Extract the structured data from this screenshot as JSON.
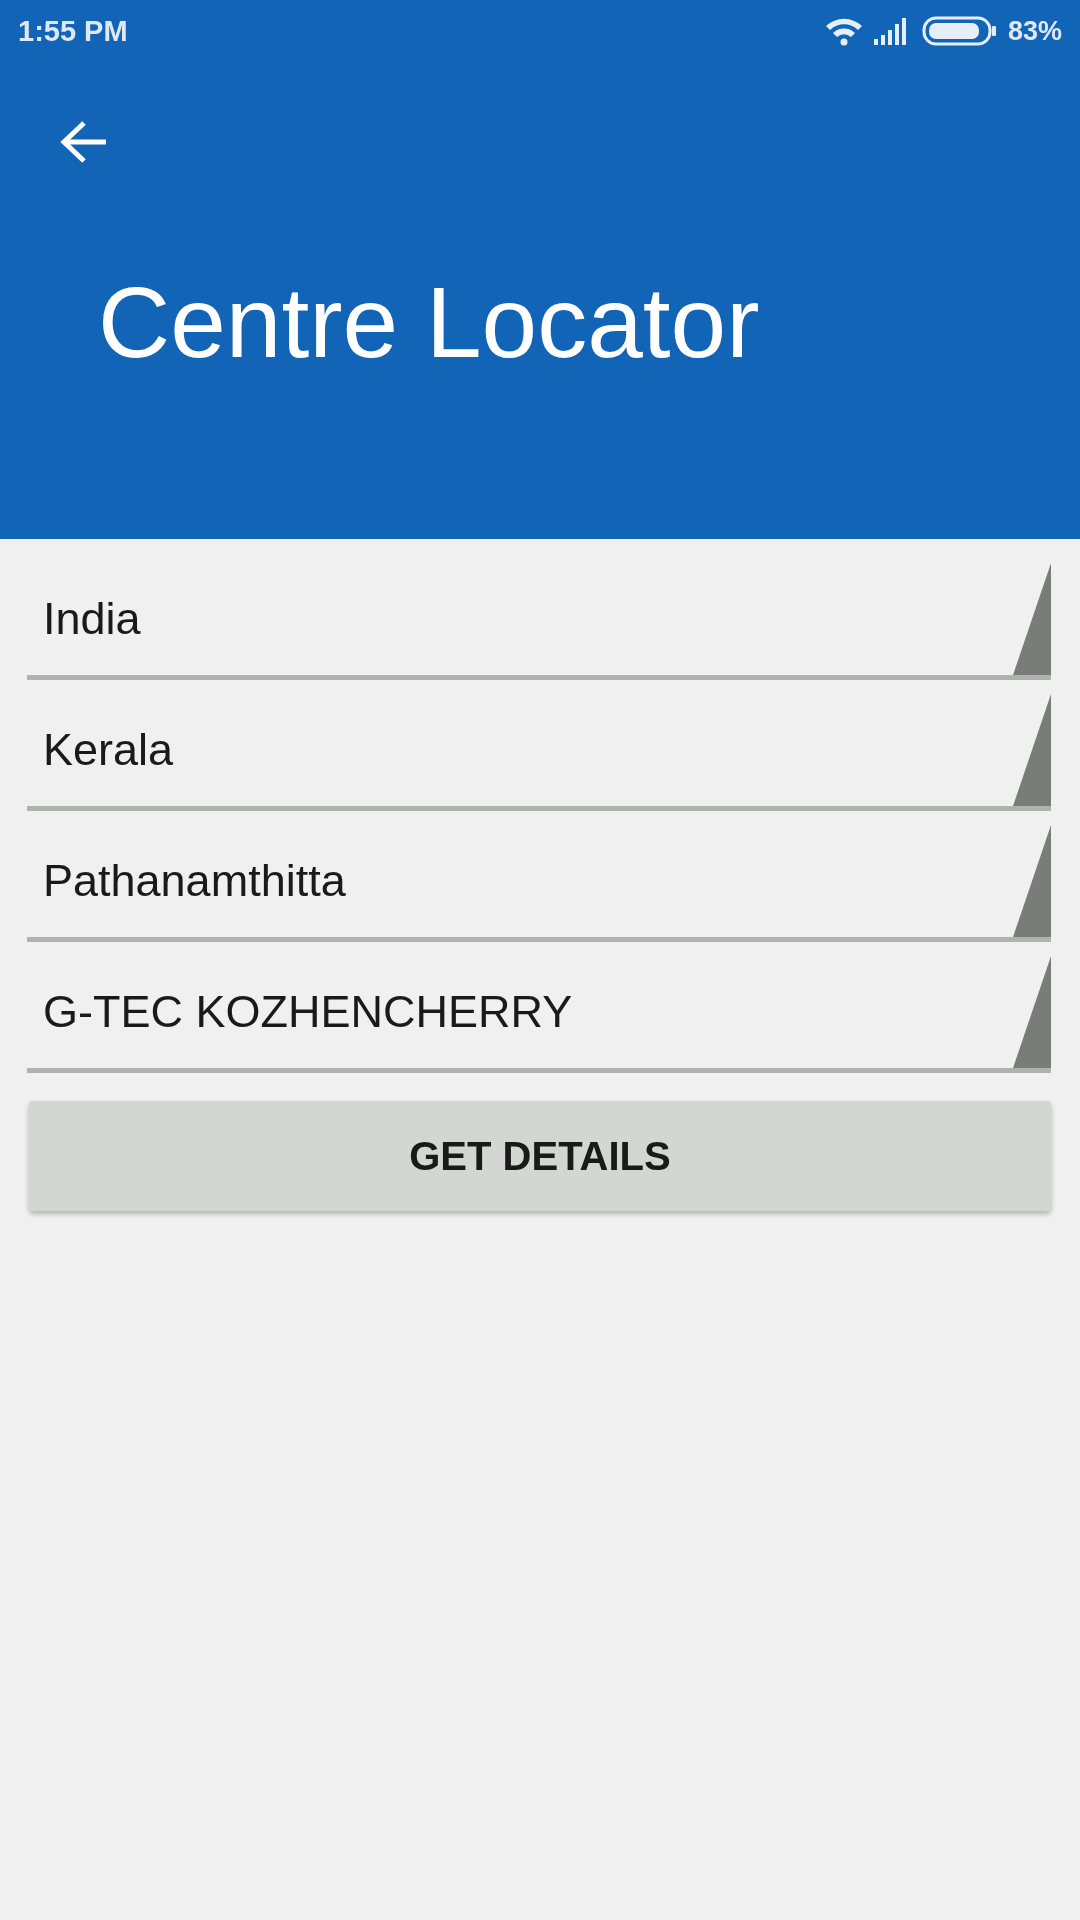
{
  "status_bar": {
    "time": "1:55 PM",
    "battery": "83%"
  },
  "app_bar": {
    "title": "Centre Locator"
  },
  "spinners": [
    {
      "value": "India"
    },
    {
      "value": "Kerala"
    },
    {
      "value": "Pathanamthitta"
    },
    {
      "value": "G-TEC KOZHENCHERRY"
    }
  ],
  "button": {
    "label": "GET DETAILS"
  }
}
